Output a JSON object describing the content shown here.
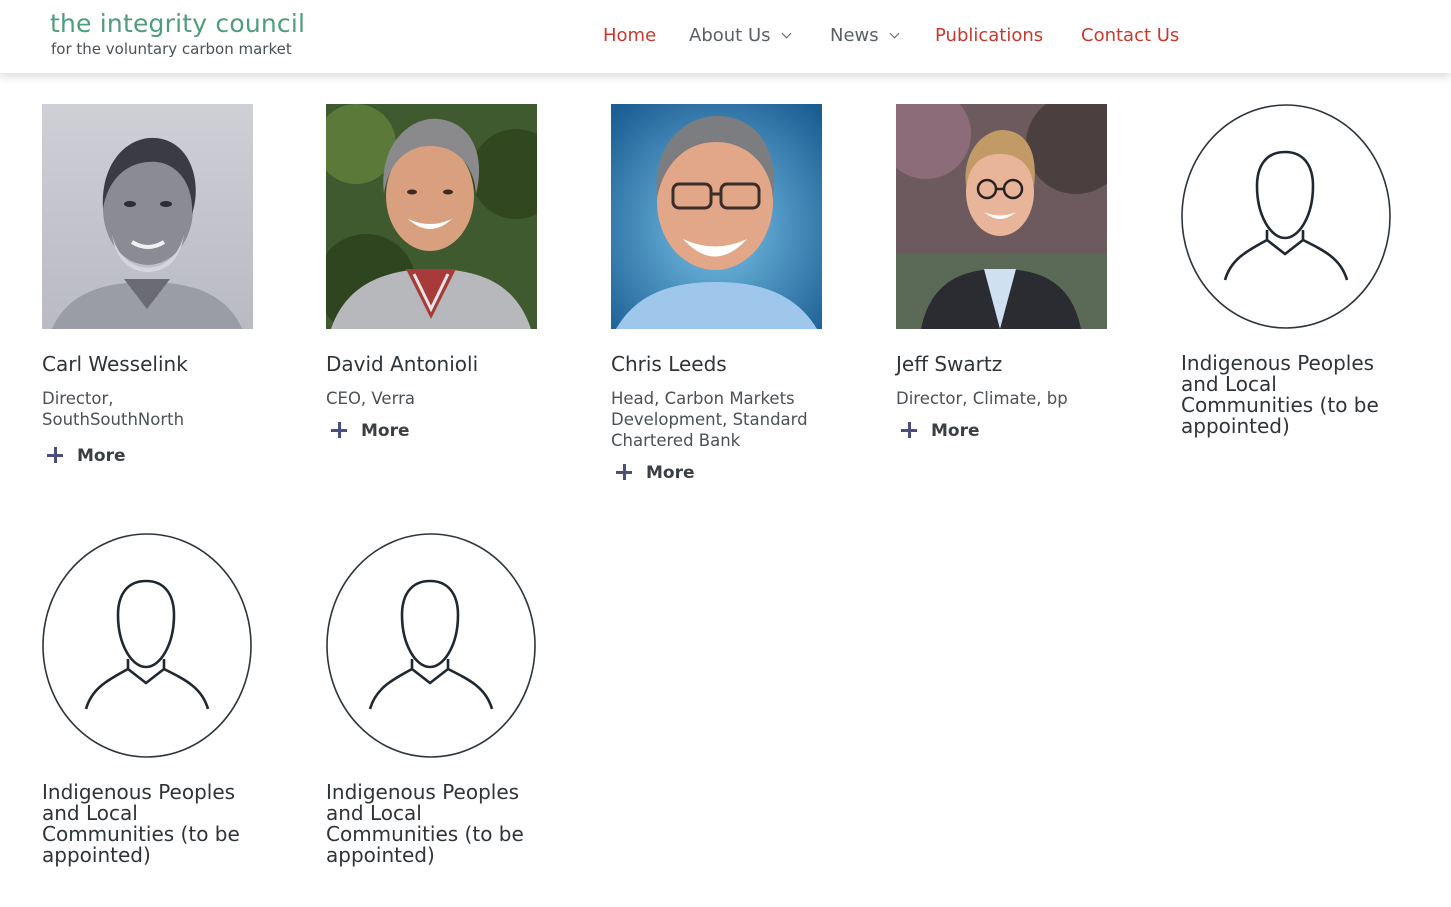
{
  "brand": {
    "title": "the integrity council",
    "subtitle": "for the voluntary carbon market"
  },
  "nav": [
    {
      "label": "Home",
      "color": "#c9382f",
      "dropdown": false
    },
    {
      "label": "About Us",
      "color": "#5b6066",
      "dropdown": true
    },
    {
      "label": "News",
      "color": "#5b6066",
      "dropdown": true
    },
    {
      "label": "Publications",
      "color": "#c9382f",
      "dropdown": false
    },
    {
      "label": "Contact Us",
      "color": "#c9382f",
      "dropdown": false
    }
  ],
  "more_label": "More",
  "members": [
    {
      "name": "Carl Wesselink",
      "role": "Director, SouthSouthNorth",
      "photo": "portrait-carl"
    },
    {
      "name": "David Antonioli",
      "role": "CEO, Verra",
      "photo": "portrait-david"
    },
    {
      "name": "Chris Leeds",
      "role": "Head, Carbon Markets Development, Standard Chartered Bank",
      "photo": "portrait-chris"
    },
    {
      "name": "Jeff Swartz",
      "role": "Director, Climate, bp",
      "photo": "portrait-jeff"
    },
    {
      "name": "Indigenous Peoples and Local Communities (to be appointed)",
      "role": "",
      "photo": "placeholder-avatar-icon"
    },
    {
      "name": "Indigenous Peoples and Local Communities (to be appointed)",
      "role": "",
      "photo": "placeholder-avatar-icon"
    },
    {
      "name": "Indigenous Peoples and Local Communities (to be appointed)",
      "role": "",
      "photo": "placeholder-avatar-icon"
    }
  ],
  "colors": {
    "brand_green": "#4f9d7c",
    "nav_red": "#c9382f",
    "nav_gray": "#5b6066",
    "plus_purple": "#4a4f80"
  }
}
